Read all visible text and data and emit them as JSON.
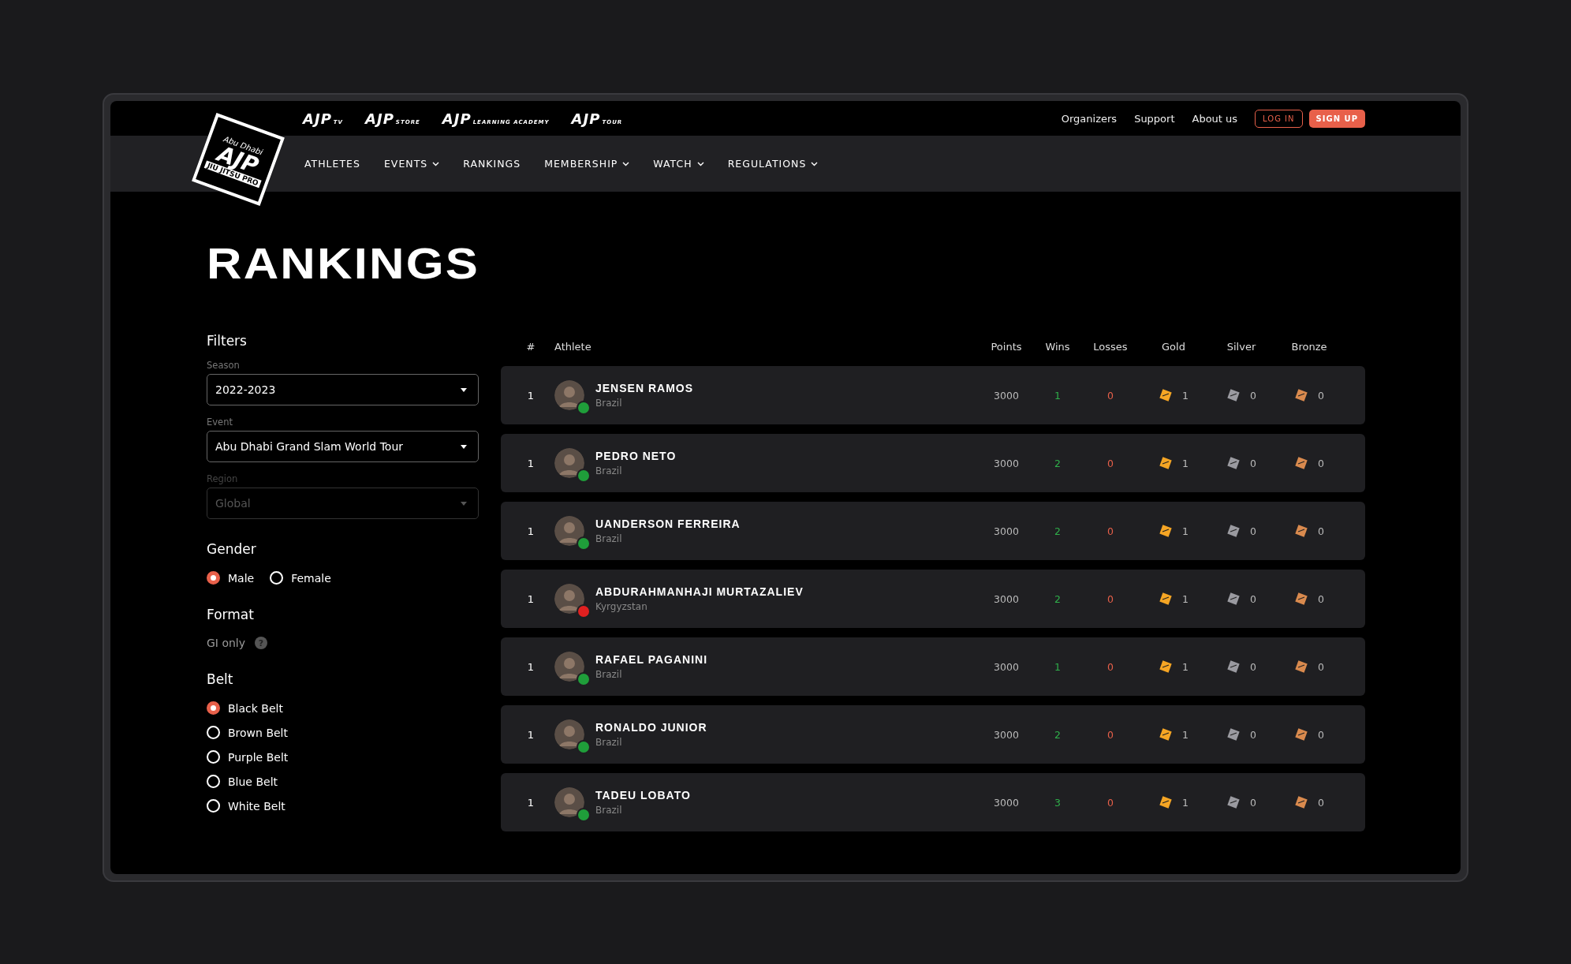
{
  "brand_links": [
    {
      "main": "AJP",
      "sub": "TV"
    },
    {
      "main": "AJP",
      "sub": "STORE"
    },
    {
      "main": "AJP",
      "sub": "LEARNING ACADEMY"
    },
    {
      "main": "AJP",
      "sub": "TOUR"
    }
  ],
  "top_links": [
    "Organizers",
    "Support",
    "About us"
  ],
  "login": "LOG IN",
  "signup": "SIGN UP",
  "logo": {
    "top": "Abu Dhabi",
    "main": "AJP",
    "sub": "JIU JITSU PRO"
  },
  "nav": [
    {
      "label": "ATHLETES",
      "dropdown": false
    },
    {
      "label": "EVENTS",
      "dropdown": true
    },
    {
      "label": "RANKINGS",
      "dropdown": false
    },
    {
      "label": "MEMBERSHIP",
      "dropdown": true
    },
    {
      "label": "WATCH",
      "dropdown": true
    },
    {
      "label": "REGULATIONS",
      "dropdown": true
    }
  ],
  "page_title": "RANKINGS",
  "filters": {
    "title": "Filters",
    "selects": [
      {
        "label": "Season",
        "value": "2022-2023",
        "disabled": false
      },
      {
        "label": "Event",
        "value": "Abu Dhabi Grand Slam World Tour",
        "disabled": false
      },
      {
        "label": "Region",
        "value": "Global",
        "disabled": true
      }
    ],
    "gender": {
      "title": "Gender",
      "options": [
        {
          "label": "Male",
          "selected": true
        },
        {
          "label": "Female",
          "selected": false
        }
      ]
    },
    "format": {
      "title": "Format",
      "text": "GI only",
      "help": "?"
    },
    "belt": {
      "title": "Belt",
      "options": [
        {
          "label": "Black Belt",
          "selected": true
        },
        {
          "label": "Brown Belt",
          "selected": false
        },
        {
          "label": "Purple Belt",
          "selected": false
        },
        {
          "label": "Blue Belt",
          "selected": false
        },
        {
          "label": "White Belt",
          "selected": false
        }
      ]
    }
  },
  "table": {
    "columns": [
      "#",
      "Athlete",
      "Points",
      "Wins",
      "Losses",
      "Gold",
      "Silver",
      "Bronze"
    ],
    "rows": [
      {
        "rank": "1",
        "name": "JENSEN RAMOS",
        "country": "Brazil",
        "color": "#1f9e3a",
        "points": "3000",
        "wins": "1",
        "losses": "0",
        "gold": "1",
        "silver": "0",
        "bronze": "0"
      },
      {
        "rank": "1",
        "name": "PEDRO NETO",
        "country": "Brazil",
        "color": "#1f9e3a",
        "points": "3000",
        "wins": "2",
        "losses": "0",
        "gold": "1",
        "silver": "0",
        "bronze": "0"
      },
      {
        "rank": "1",
        "name": "UANDERSON FERREIRA",
        "country": "Brazil",
        "color": "#1f9e3a",
        "points": "3000",
        "wins": "2",
        "losses": "0",
        "gold": "1",
        "silver": "0",
        "bronze": "0"
      },
      {
        "rank": "1",
        "name": "ABDURAHMANHAJI MURTAZALIEV",
        "country": "Kyrgyzstan",
        "color": "#e02020",
        "points": "3000",
        "wins": "2",
        "losses": "0",
        "gold": "1",
        "silver": "0",
        "bronze": "0"
      },
      {
        "rank": "1",
        "name": "RAFAEL PAGANINI",
        "country": "Brazil",
        "color": "#1f9e3a",
        "points": "3000",
        "wins": "1",
        "losses": "0",
        "gold": "1",
        "silver": "0",
        "bronze": "0"
      },
      {
        "rank": "1",
        "name": "RONALDO JUNIOR",
        "country": "Brazil",
        "color": "#1f9e3a",
        "points": "3000",
        "wins": "2",
        "losses": "0",
        "gold": "1",
        "silver": "0",
        "bronze": "0"
      },
      {
        "rank": "1",
        "name": "TADEU LOBATO",
        "country": "Brazil",
        "color": "#1f9e3a",
        "points": "3000",
        "wins": "3",
        "losses": "0",
        "gold": "1",
        "silver": "0",
        "bronze": "0"
      }
    ]
  }
}
